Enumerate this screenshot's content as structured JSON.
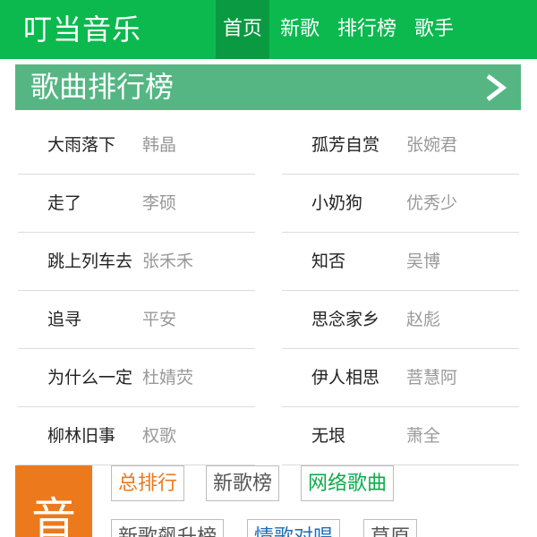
{
  "header": {
    "logo": "叮当音乐",
    "nav": [
      {
        "label": "首页",
        "active": true
      },
      {
        "label": "新歌",
        "active": false
      },
      {
        "label": "排行榜",
        "active": false
      },
      {
        "label": "歌手",
        "active": false
      }
    ]
  },
  "chart_section": {
    "title": "歌曲排行榜",
    "arrow_icon": "chevron-right-icon",
    "songs": [
      {
        "title": "大雨落下",
        "artist": "韩晶"
      },
      {
        "title": "孤芳自赏",
        "artist": "张婉君"
      },
      {
        "title": "走了",
        "artist": "李硕"
      },
      {
        "title": "小奶狗",
        "artist": "优秀少"
      },
      {
        "title": "跳上列车去",
        "artist": "张禾禾"
      },
      {
        "title": "知否",
        "artist": "吴博"
      },
      {
        "title": "追寻",
        "artist": "平安"
      },
      {
        "title": "思念家乡",
        "artist": "赵彪"
      },
      {
        "title": "为什么一定",
        "artist": "杜婧荧"
      },
      {
        "title": "伊人相思",
        "artist": "菩慧阿"
      },
      {
        "title": "柳林旧事",
        "artist": "权歌"
      },
      {
        "title": "无垠",
        "artist": "萧全"
      }
    ]
  },
  "category_section": {
    "block_char": "音",
    "tags": [
      {
        "label": "总排行",
        "color": "#ec7a1c"
      },
      {
        "label": "新歌榜",
        "color": "#555555"
      },
      {
        "label": "网络歌曲",
        "color": "#0cab4a"
      },
      {
        "label": "新歌飙升榜",
        "color": "#555555"
      },
      {
        "label": "情歌对唱",
        "color": "#1e6fb8"
      },
      {
        "label": "草原",
        "color": "#555555"
      }
    ]
  },
  "colors": {
    "header_bg": "#0cb94f",
    "nav_active_bg": "#0a9a41",
    "banner_bg": "#55b684",
    "orange_accent": "#ec7a1c"
  }
}
